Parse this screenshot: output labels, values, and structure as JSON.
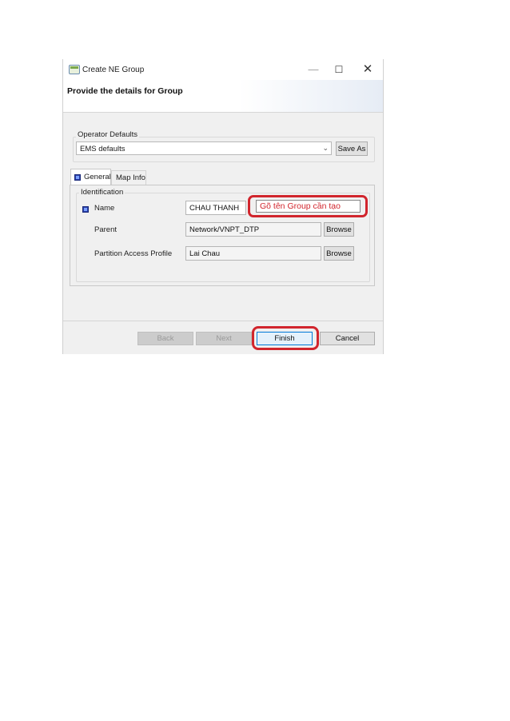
{
  "window": {
    "title": "Create NE Group",
    "controls": {
      "minimize": "—",
      "maximize": "☐",
      "close": "✕"
    }
  },
  "header": {
    "title": "Provide the details for Group"
  },
  "operator_defaults": {
    "label": "Operator Defaults",
    "selected": "EMS defaults",
    "save_as_label": "Save As"
  },
  "tabs": [
    {
      "label": "General",
      "active": true
    },
    {
      "label": "Map Info",
      "active": false
    }
  ],
  "identification": {
    "label": "Identification",
    "fields": {
      "name": {
        "label": "Name",
        "value": "CHAU THANH"
      },
      "parent": {
        "label": "Parent",
        "value": "Network/VNPT_DTP",
        "browse_label": "Browse"
      },
      "partition": {
        "label": "Partition Access Profile",
        "value": "Lai Chau",
        "browse_label": "Browse"
      }
    }
  },
  "annotation": {
    "text": "Gõ tên Group cần tạo",
    "color": "#d1252d"
  },
  "footer": {
    "back_label": "Back",
    "next_label": "Next",
    "finish_label": "Finish",
    "cancel_label": "Cancel"
  },
  "icons": {
    "app": "ne-group-icon",
    "general_tab": "square-bullet-icon",
    "name_required": "square-bullet-icon",
    "dropdown": "chevron-down-icon"
  }
}
